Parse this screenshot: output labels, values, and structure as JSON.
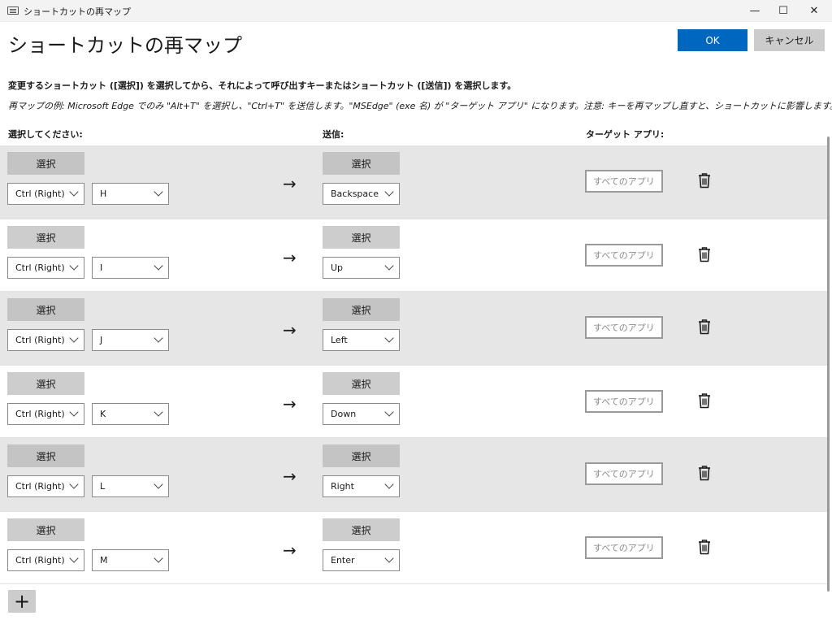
{
  "window": {
    "title": "ショートカットの再マップ",
    "minimize_glyph": "—",
    "maximize_glyph": "☐",
    "close_glyph": "✕"
  },
  "page_title": "ショートカットの再マップ",
  "buttons": {
    "ok": "OK",
    "cancel": "キャンセル",
    "add": "+"
  },
  "instructions": {
    "line1": "変更するショートカット ([選択]) を選択してから、それによって呼び出すキーまたはショートカット ([送信]) を選択します。",
    "line2": "再マップの例: Microsoft Edge でのみ \"Alt+T\" を選択し、\"Ctrl+T\" を送信します。\"MSEdge\" (exe 名) が \"ターゲット アプリ\" になります。注意: キーを再マップし直すと、ショートカットに影響します。"
  },
  "headers": {
    "select": "選択してください:",
    "send": "送信:",
    "target": "ターゲット アプリ:"
  },
  "colors": {
    "accent": "#0067c0",
    "row_shaded": "#e6e6e6"
  },
  "rows": [
    {
      "select_label": "選択",
      "modifier": "Ctrl (Right)",
      "key": "H",
      "arrow": "→",
      "send_label": "選択",
      "send_value": "Backspace",
      "target_placeholder": "すべてのアプリ",
      "icon": "trash-icon"
    },
    {
      "select_label": "選択",
      "modifier": "Ctrl (Right)",
      "key": "I",
      "arrow": "→",
      "send_label": "選択",
      "send_value": "Up",
      "target_placeholder": "すべてのアプリ",
      "icon": "trash-icon"
    },
    {
      "select_label": "選択",
      "modifier": "Ctrl (Right)",
      "key": "J",
      "arrow": "→",
      "send_label": "選択",
      "send_value": "Left",
      "target_placeholder": "すべてのアプリ",
      "icon": "trash-icon"
    },
    {
      "select_label": "選択",
      "modifier": "Ctrl (Right)",
      "key": "K",
      "arrow": "→",
      "send_label": "選択",
      "send_value": "Down",
      "target_placeholder": "すべてのアプリ",
      "icon": "trash-icon"
    },
    {
      "select_label": "選択",
      "modifier": "Ctrl (Right)",
      "key": "L",
      "arrow": "→",
      "send_label": "選択",
      "send_value": "Right",
      "target_placeholder": "すべてのアプリ",
      "icon": "trash-icon"
    },
    {
      "select_label": "選択",
      "modifier": "Ctrl (Right)",
      "key": "M",
      "arrow": "→",
      "send_label": "選択",
      "send_value": "Enter",
      "target_placeholder": "すべてのアプリ",
      "icon": "trash-icon"
    }
  ]
}
